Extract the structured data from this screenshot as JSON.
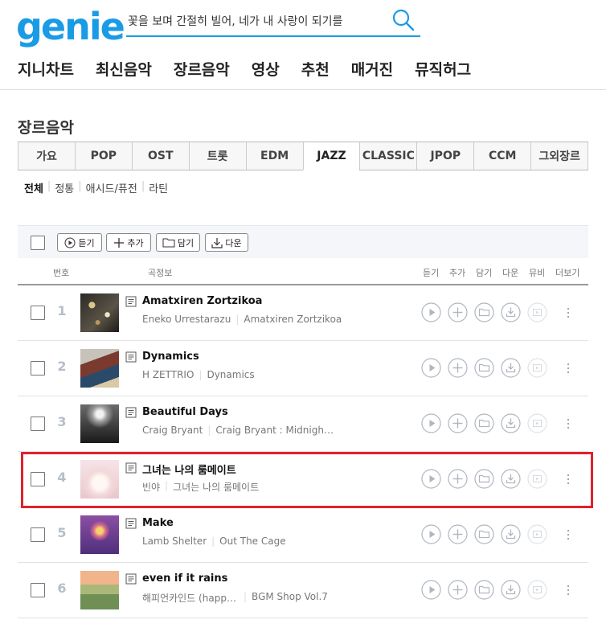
{
  "logo": "genie",
  "search": {
    "query": "꽃을 보며 간절히 빌어, 네가 내 사랑이 되기를"
  },
  "gnb": [
    "지니차트",
    "최신음악",
    "장르음악",
    "영상",
    "추천",
    "매거진",
    "뮤직허그"
  ],
  "page_title": "장르음악",
  "genre_tabs": [
    "가요",
    "POP",
    "OST",
    "트롯",
    "EDM",
    "JAZZ",
    "CLASSIC",
    "JPOP",
    "CCM",
    "그외장르"
  ],
  "active_tab": "JAZZ",
  "subgenres": [
    "전체",
    "정통",
    "애시드/퓨전",
    "라틴"
  ],
  "toolbar": {
    "listen": "듣기",
    "add": "추가",
    "save": "담기",
    "download": "다운"
  },
  "headers": {
    "no": "번호",
    "info": "곡정보",
    "listen": "듣기",
    "add": "추가",
    "save": "담기",
    "download": "다운",
    "mv": "뮤비",
    "more": "더보기"
  },
  "songs": [
    {
      "rank": "1",
      "title": "Amatxiren Zortzikoa",
      "artist": "Eneko Urrestarazu",
      "album": "Amatxiren Zortzikoa"
    },
    {
      "rank": "2",
      "title": "Dynamics",
      "artist": "H ZETTRIO",
      "album": "Dynamics"
    },
    {
      "rank": "3",
      "title": "Beautiful Days",
      "artist": "Craig Bryant",
      "album": "Craig Bryant : Midnight Moods"
    },
    {
      "rank": "4",
      "title": "그녀는 나의 룸메이트",
      "artist": "빈야",
      "album": "그녀는 나의 룸메이트"
    },
    {
      "rank": "5",
      "title": "Make",
      "artist": "Lamb Shelter",
      "album": "Out The Cage"
    },
    {
      "rank": "6",
      "title": "even if it rains",
      "artist": "해피언카인드 (happyUnkind)",
      "album": "BGM Shop Vol.7"
    }
  ],
  "colors": {
    "brand": "#1a9be6",
    "highlight": "#e0212b",
    "rank": "#b5bec9"
  }
}
